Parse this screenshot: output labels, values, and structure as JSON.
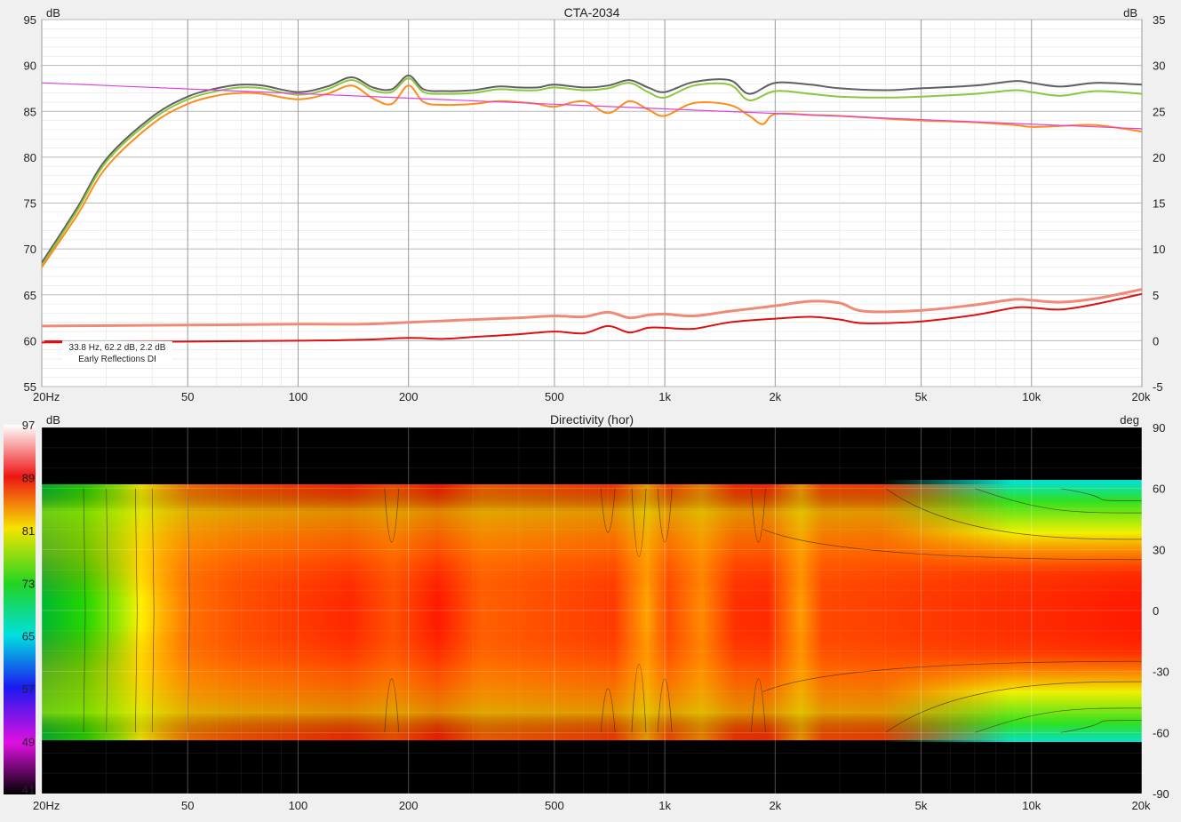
{
  "chart_data": [
    {
      "type": "line",
      "title": "CTA-2034",
      "ylabel": "dB",
      "y2label": "dB",
      "xscale": "log",
      "xlim": [
        20,
        20000
      ],
      "ylim": [
        55,
        95
      ],
      "y2lim": [
        -5,
        35
      ],
      "grid": true,
      "x_ticks": [
        {
          "v": 20,
          "label": "20Hz"
        },
        {
          "v": 50,
          "label": "50"
        },
        {
          "v": 100,
          "label": "100"
        },
        {
          "v": 200,
          "label": "200"
        },
        {
          "v": 500,
          "label": "500"
        },
        {
          "v": 1000,
          "label": "1k"
        },
        {
          "v": 2000,
          "label": "2k"
        },
        {
          "v": 5000,
          "label": "5k"
        },
        {
          "v": 10000,
          "label": "10k"
        },
        {
          "v": 20000,
          "label": "20k"
        }
      ],
      "y_ticks": [
        "95",
        "90",
        "85",
        "80",
        "75",
        "70",
        "65",
        "60",
        "55"
      ],
      "y2_ticks": [
        "35",
        "30",
        "25",
        "20",
        "15",
        "10",
        "5",
        "0",
        "-5"
      ],
      "cursor_readout": [
        "33.8 Hz, 62.2 dB, 2.2 dB",
        "Early Reflections DI"
      ],
      "series": [
        {
          "axis": "left",
          "color": "#606060",
          "x": [
            20,
            25,
            30,
            40,
            50,
            60,
            70,
            80,
            100,
            120,
            140,
            160,
            180,
            200,
            220,
            250,
            300,
            350,
            400,
            450,
            500,
            600,
            700,
            800,
            900,
            1000,
            1200,
            1500,
            1700,
            2000,
            2500,
            3000,
            4000,
            5000,
            7000,
            9000,
            10000,
            12000,
            15000,
            20000
          ],
          "y": [
            68.5,
            74.5,
            79.8,
            84.4,
            86.6,
            87.5,
            87.9,
            87.8,
            87.1,
            87.7,
            88.7,
            87.6,
            87.4,
            88.9,
            87.4,
            87.2,
            87.3,
            87.7,
            87.6,
            87.6,
            87.9,
            87.6,
            87.8,
            88.4,
            87.6,
            87.1,
            88.2,
            88.4,
            86.9,
            88.1,
            87.9,
            87.5,
            87.3,
            87.5,
            87.8,
            88.3,
            88.1,
            87.7,
            88.1,
            87.9
          ]
        },
        {
          "axis": "left",
          "color": "#8cc63f",
          "x": [
            20,
            25,
            30,
            40,
            50,
            60,
            70,
            80,
            100,
            120,
            140,
            160,
            180,
            200,
            220,
            250,
            300,
            350,
            400,
            450,
            500,
            600,
            700,
            800,
            900,
            1000,
            1200,
            1500,
            1700,
            2000,
            2500,
            3000,
            4000,
            5000,
            7000,
            9000,
            10000,
            12000,
            15000,
            20000
          ],
          "y": [
            68.2,
            74.2,
            79.5,
            84.1,
            86.3,
            87.2,
            87.6,
            87.5,
            86.8,
            87.4,
            88.4,
            87.3,
            87.1,
            88.6,
            87.1,
            86.9,
            87.0,
            87.4,
            87.3,
            87.3,
            87.6,
            87.3,
            87.5,
            88.1,
            87.1,
            86.5,
            87.8,
            87.9,
            86.2,
            87.2,
            86.9,
            86.6,
            86.5,
            86.6,
            86.9,
            87.3,
            87.1,
            86.7,
            87.2,
            86.9
          ]
        },
        {
          "axis": "left",
          "color": "#ff8c1a",
          "x": [
            20,
            25,
            30,
            40,
            50,
            60,
            70,
            80,
            100,
            120,
            140,
            160,
            180,
            200,
            220,
            250,
            300,
            350,
            400,
            450,
            500,
            600,
            700,
            800,
            900,
            1000,
            1200,
            1500,
            1700,
            1850,
            2000,
            2500,
            3000,
            4000,
            5000,
            7000,
            9000,
            10000,
            12000,
            15000,
            20000
          ],
          "y": [
            68.0,
            73.7,
            78.9,
            83.6,
            85.8,
            86.7,
            87.0,
            86.9,
            86.3,
            86.9,
            87.8,
            86.4,
            85.8,
            87.8,
            86.0,
            85.7,
            85.8,
            86.1,
            86.0,
            85.8,
            85.5,
            86.1,
            84.8,
            86.1,
            85.2,
            84.5,
            85.9,
            85.7,
            84.5,
            83.6,
            84.7,
            84.6,
            84.5,
            84.2,
            84.0,
            83.8,
            83.5,
            83.3,
            83.4,
            83.5,
            82.8
          ]
        },
        {
          "axis": "left",
          "color": "#e040e0",
          "x": [
            20,
            20000
          ],
          "y": [
            88.1,
            83.1
          ]
        },
        {
          "axis": "right",
          "color": "#f08a78",
          "x": [
            20,
            50,
            100,
            150,
            200,
            300,
            400,
            500,
            600,
            700,
            800,
            900,
            1000,
            1200,
            1500,
            2000,
            2500,
            3000,
            3500,
            5000,
            7000,
            9000,
            10000,
            12000,
            15000,
            20000
          ],
          "y": [
            1.6,
            1.7,
            1.8,
            1.8,
            2.0,
            2.3,
            2.5,
            2.7,
            2.6,
            3.1,
            2.5,
            2.8,
            2.9,
            2.7,
            3.2,
            3.8,
            4.3,
            4.1,
            3.2,
            3.3,
            3.9,
            4.5,
            4.4,
            4.2,
            4.6,
            5.6
          ]
        },
        {
          "axis": "right",
          "color": "#dd1111",
          "x": [
            20,
            50,
            100,
            150,
            200,
            250,
            300,
            400,
            500,
            600,
            700,
            800,
            900,
            1000,
            1200,
            1500,
            2000,
            2500,
            3000,
            3500,
            5000,
            7000,
            9000,
            10000,
            12000,
            15000,
            20000
          ],
          "y": [
            -0.2,
            -0.1,
            0.0,
            0.1,
            0.3,
            0.2,
            0.4,
            0.7,
            1.0,
            0.8,
            1.6,
            0.9,
            1.4,
            1.4,
            1.3,
            2.0,
            2.4,
            2.6,
            2.3,
            1.9,
            2.1,
            2.8,
            3.6,
            3.6,
            3.4,
            4.0,
            5.1
          ]
        }
      ]
    },
    {
      "type": "heatmap",
      "title": "Directivity (hor)",
      "ylabel": "dB",
      "y2label": "deg",
      "xscale": "log",
      "xlim": [
        20,
        20000
      ],
      "ylim": [
        -90,
        90
      ],
      "x_ticks": [
        {
          "v": 20,
          "label": "20Hz"
        },
        {
          "v": 50,
          "label": "50"
        },
        {
          "v": 100,
          "label": "100"
        },
        {
          "v": 200,
          "label": "200"
        },
        {
          "v": 500,
          "label": "500"
        },
        {
          "v": 1000,
          "label": "1k"
        },
        {
          "v": 2000,
          "label": "2k"
        },
        {
          "v": 5000,
          "label": "5k"
        },
        {
          "v": 10000,
          "label": "10k"
        },
        {
          "v": 20000,
          "label": "20k"
        }
      ],
      "angle_ticks": [
        "90",
        "60",
        "30",
        "0",
        "-30",
        "-60",
        "-90"
      ],
      "colorbar_ticks": [
        "97",
        "89",
        "81",
        "73",
        "65",
        "57",
        "49",
        "41"
      ],
      "colorbar_range": [
        41,
        97
      ],
      "angle_range_measured": [
        -60,
        60
      ]
    }
  ]
}
